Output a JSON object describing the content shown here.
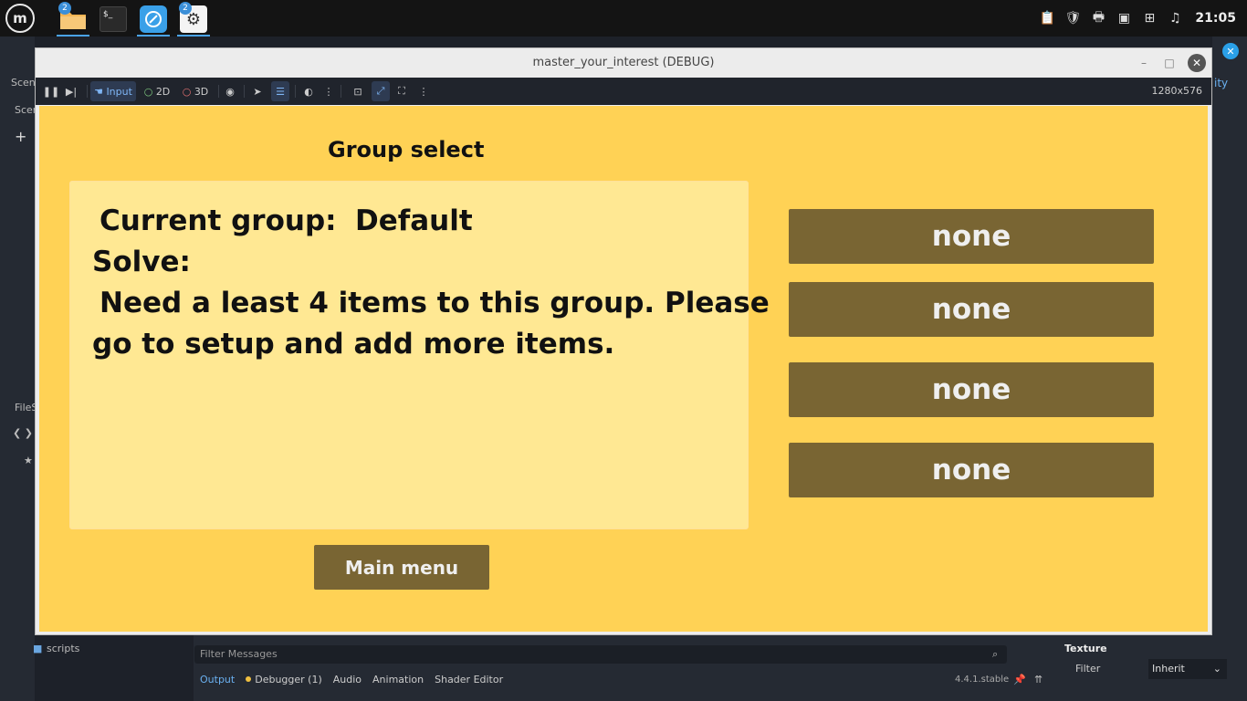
{
  "taskbar": {
    "files_badge": "2",
    "settings_badge": "2",
    "terminal_glyph": "$_",
    "clock": "21:05"
  },
  "editor": {
    "scene_tab": "Scene",
    "scene_panel_label": "Scen",
    "filesystem_label": "FileS",
    "scripts_folder": "scripts",
    "filter_placeholder": "Filter Messages",
    "bottom_tabs": {
      "output": "Output",
      "debugger": "Debugger (1)",
      "audio": "Audio",
      "animation": "Animation",
      "shader_editor": "Shader Editor"
    },
    "version": "4.4.1.stable",
    "inspector_fragment": "ity",
    "texture_header": "Texture",
    "filter_label": "Filter",
    "filter_value": "Inherit"
  },
  "window": {
    "title": "master_your_interest (DEBUG)",
    "minimize": "–",
    "maximize": "□",
    "close": "✕"
  },
  "toolbar": {
    "input_label": "Input",
    "mode_2d": "2D",
    "mode_3d": "3D",
    "resolution": "1280x576"
  },
  "game": {
    "title": "Group select",
    "current_group_label": "Current group:",
    "current_group_value": "Default",
    "solve_label": "Solve:",
    "message_line1": "Need a least 4 items to this group. Please",
    "message_line2": "go to setup and add more items.",
    "group_buttons": [
      "none",
      "none",
      "none",
      "none"
    ],
    "main_menu": "Main menu"
  },
  "colors": {
    "viewport_bg": "#ffd255",
    "info_bg": "#ffe893",
    "button_bg": "#796533",
    "button_text": "#efefef"
  }
}
